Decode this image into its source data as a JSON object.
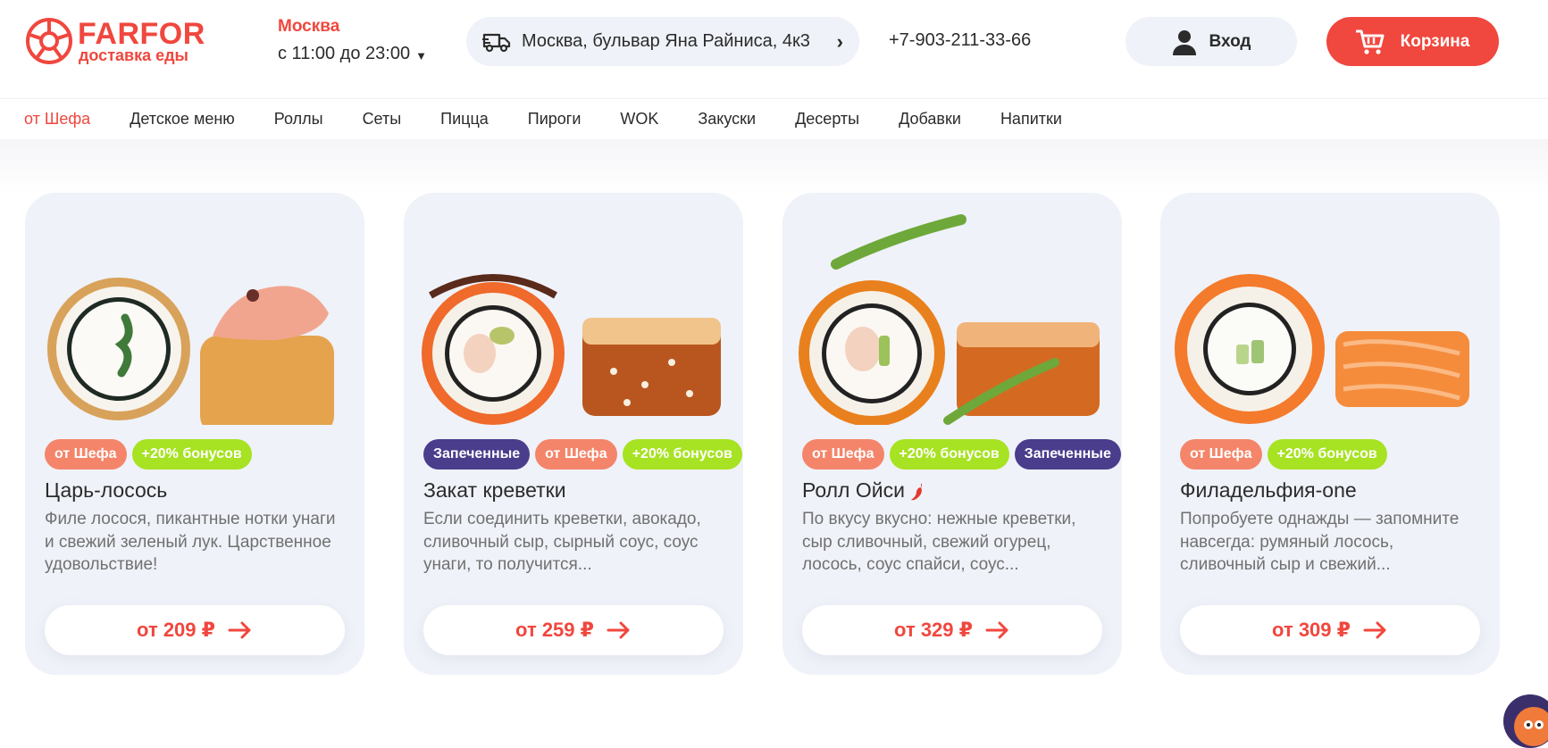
{
  "header": {
    "logo_name": "FARFOR",
    "logo_sub": "доставка еды",
    "city": "Москва",
    "hours": "с 11:00 до 23:00",
    "address": "Москва, бульвар Яна Райниса, 4к3",
    "phone": "+7-903-211-33-66",
    "login_label": "Вход",
    "cart_label": "Корзина",
    "icons": [
      "logo-mark",
      "truck-icon",
      "chevron-right-icon",
      "user-icon",
      "cart-icon",
      "chevron-down-icon"
    ]
  },
  "nav": {
    "items": [
      "от Шефа",
      "Детское меню",
      "Роллы",
      "Сеты",
      "Пицца",
      "Пироги",
      "WOK",
      "Закуски",
      "Десерты",
      "Добавки",
      "Напитки"
    ],
    "active_index": 0
  },
  "cards": [
    {
      "tags": [
        "от Шефа",
        "+20% бонусов"
      ],
      "title": "Царь-лосось",
      "desc": "Филе лосося, пикантные нотки унаги и свежий зеленый лук. Царственное удовольствие!",
      "price": "от 209 ₽"
    },
    {
      "tags": [
        "Запеченные",
        "от Шефа",
        "+20% бонусов"
      ],
      "title": "Закат креветки",
      "desc": "Если соединить креветки, авокадо, сливочный сыр, сырный соус, соус унаги, то получится...",
      "price": "от 259 ₽"
    },
    {
      "tags": [
        "от Шефа",
        "+20% бонусов",
        "Запеченные"
      ],
      "title": "Ролл Ойси",
      "desc": "По вкусу вкусно: нежные креветки, сыр сливочный, свежий огурец, лосось, соус спайси, соус...",
      "price": "от 329 ₽",
      "spicy": true
    },
    {
      "tags": [
        "от Шефа",
        "+20% бонусов"
      ],
      "title": "Филадельфия-one",
      "desc": "Попробуете однажды — запомните навсегда: румяный лосось, сливочный сыр и свежий...",
      "price": "от 309 ₽"
    }
  ],
  "colors": {
    "brand_red": "#f0473e",
    "tag_chef": "#f4856a",
    "tag_bonus": "#a7e223",
    "tag_baked": "#4a3d8c",
    "card_bg": "#eff2f8"
  }
}
